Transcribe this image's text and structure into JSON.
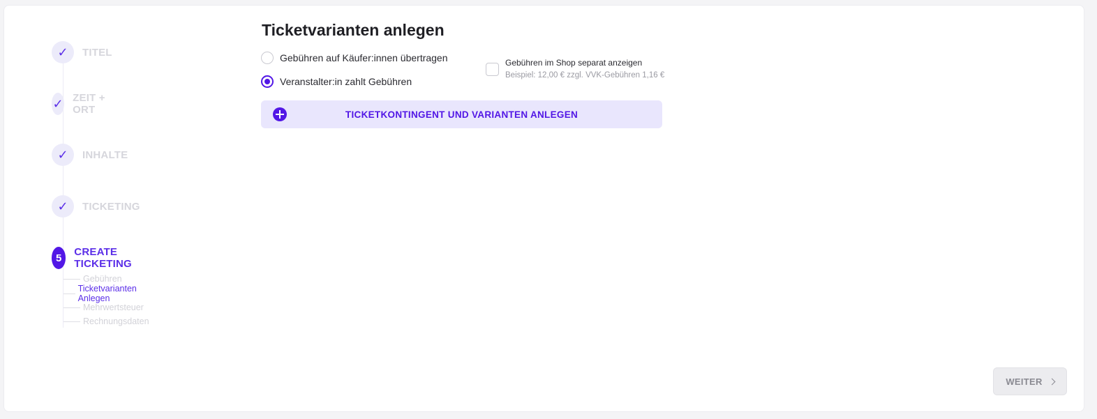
{
  "stepper": {
    "steps": [
      {
        "marker": "✓",
        "label": "TITEL",
        "state": "done"
      },
      {
        "marker": "✓",
        "label": "ZEIT + ORT",
        "state": "done"
      },
      {
        "marker": "✓",
        "label": "INHALTE",
        "state": "done"
      },
      {
        "marker": "✓",
        "label": "TICKETING",
        "state": "done"
      },
      {
        "marker": "5",
        "label": "CREATE TICKETING",
        "state": "active"
      }
    ],
    "substeps": [
      {
        "label": "Gebühren",
        "active": false
      },
      {
        "label": "Ticketvarianten Anlegen",
        "active": true
      },
      {
        "label": "Mehrwertsteuer",
        "active": false
      },
      {
        "label": "Rechnungsdaten",
        "active": false
      }
    ]
  },
  "main": {
    "title": "Ticketvarianten anlegen",
    "fee_options": [
      {
        "label": "Gebühren auf Käufer:innen übertragen",
        "checked": false
      },
      {
        "label": "Veranstalter:in zahlt Gebühren",
        "checked": true
      }
    ],
    "show_fees_checkbox": {
      "label": "Gebühren im Shop separat anzeigen",
      "hint": "Beispiel: 12,00 € zzgl. VVK-Gebühren 1,16 €",
      "checked": false
    },
    "add_button_label": "TICKETKONTINGENT UND VARIANTEN ANLEGEN"
  },
  "footer": {
    "next_label": "WEITER"
  },
  "colors": {
    "accent": "#5217e6",
    "accent_light": "#e9e6fd",
    "muted": "#d6d6dc"
  }
}
